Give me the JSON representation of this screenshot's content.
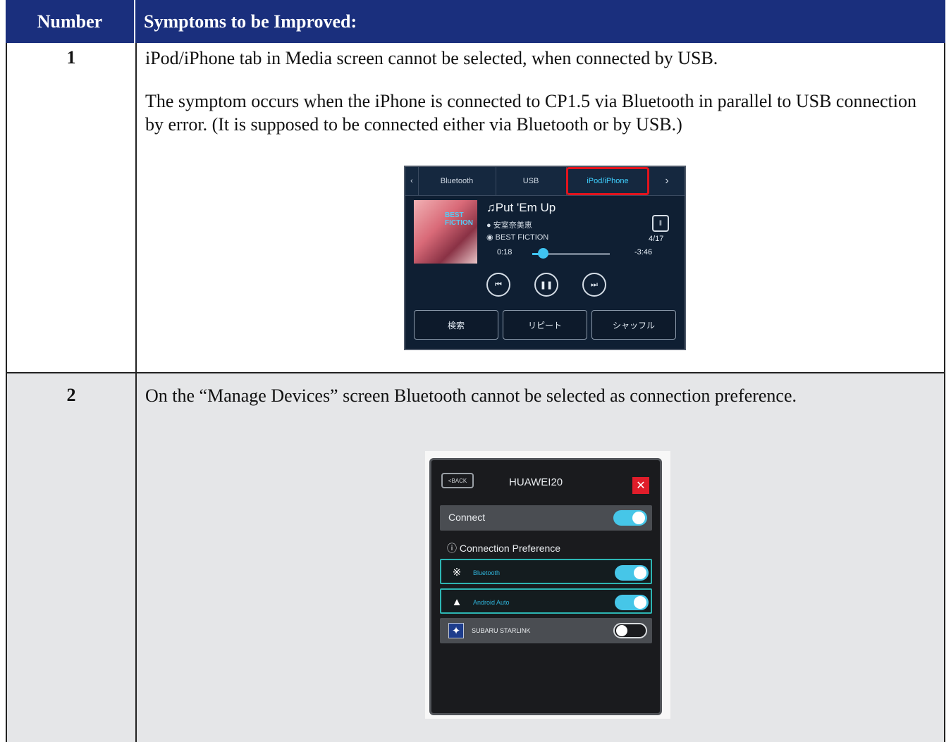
{
  "header": {
    "col_number": "Number",
    "col_symptoms": "Symptoms to be Improved:"
  },
  "rows": [
    {
      "number": "1",
      "text1": "iPod/iPhone tab in Media screen cannot be selected, when connected by USB.",
      "text2": "The symptom occurs when the iPhone is connected to CP1.5 via Bluetooth in parallel to USB connection by error. (It is supposed to be connected either via Bluetooth or by USB.)"
    },
    {
      "number": "2",
      "text1": "On the “Manage Devices” screen Bluetooth cannot be selected as connection preference."
    }
  ],
  "media_screen": {
    "tabs": [
      "Bluetooth",
      "USB",
      "iPod/iPhone"
    ],
    "selected_tab": "iPod/iPhone",
    "album_label": "BEST FICTION",
    "song": "♫Put 'Em Up",
    "artist": "安室奈美恵",
    "album": "BEST FICTION",
    "track": "4/17",
    "time_elapsed": "0:18",
    "time_remaining": "-3:46",
    "progress": 0.08,
    "buttons": [
      "検索",
      "リピート",
      "シャッフル"
    ],
    "highlight_color": "#e2141d"
  },
  "manage_devices": {
    "back_label": "BACK",
    "device_name": "HUAWEI20",
    "connect_label": "Connect",
    "connect_on": true,
    "preference_header": "ⓘ Connection Preference",
    "options": [
      {
        "label": "Bluetooth",
        "on": true
      },
      {
        "label": "Android Auto",
        "on": true
      },
      {
        "label": "SUBARU STARLINK",
        "on": false
      }
    ]
  }
}
